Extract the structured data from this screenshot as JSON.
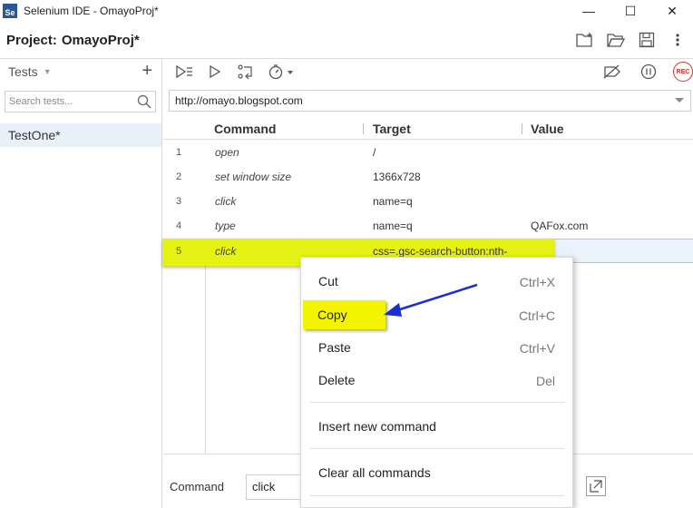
{
  "window": {
    "title": "Selenium IDE - OmayoProj*",
    "app_icon_text": "Se",
    "minimize": "—",
    "maximize": "☐",
    "close": "✕"
  },
  "project": {
    "label": "Project:",
    "name": "OmayoProj*"
  },
  "sidebar": {
    "title": "Tests",
    "add": "+",
    "search_placeholder": "Search tests...",
    "tests": [
      "TestOne*"
    ]
  },
  "url": {
    "value": "http://omayo.blogspot.com"
  },
  "table": {
    "headers": {
      "command": "Command",
      "target": "Target",
      "value": "Value"
    },
    "rows": [
      {
        "num": "1",
        "command": "open",
        "target": "/",
        "value": ""
      },
      {
        "num": "2",
        "command": "set window size",
        "target": "1366x728",
        "value": ""
      },
      {
        "num": "3",
        "command": "click",
        "target": "name=q",
        "value": ""
      },
      {
        "num": "4",
        "command": "type",
        "target": "name=q",
        "value": "QAFox.com"
      },
      {
        "num": "5",
        "command": "click",
        "target": "css=.gsc-search-button:nth-",
        "value": ""
      }
    ],
    "selected_row": 5
  },
  "command_bar": {
    "label": "Command",
    "value": "click"
  },
  "context_menu": {
    "items": [
      {
        "label": "Cut",
        "shortcut": "Ctrl+X"
      },
      {
        "label": "Copy",
        "shortcut": "Ctrl+C"
      },
      {
        "label": "Paste",
        "shortcut": "Ctrl+V"
      },
      {
        "label": "Delete",
        "shortcut": "Del"
      },
      {
        "label": "Insert new command",
        "shortcut": ""
      },
      {
        "label": "Clear all commands",
        "shortcut": ""
      }
    ]
  },
  "colors": {
    "highlight": "#e5f200",
    "arrow": "#1a2fd0",
    "record": "#d33333",
    "selection": "#eaf2fb"
  },
  "icons": {
    "toolbar": [
      "run-all-icon",
      "run-icon",
      "step-icon",
      "speed-icon"
    ],
    "project": [
      "new-project-icon",
      "open-project-icon",
      "save-project-icon",
      "more-icon"
    ],
    "right": [
      "disable-breakpoints-icon",
      "pause-icon",
      "record-icon"
    ]
  },
  "record_label": "REC"
}
